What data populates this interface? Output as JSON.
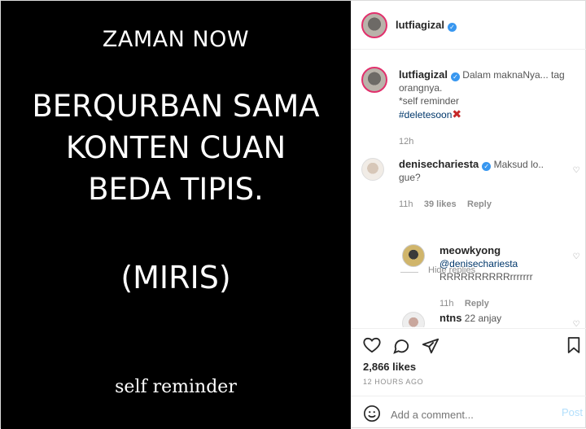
{
  "post_image": {
    "heading": "ZAMAN NOW",
    "line1": "BERQURBAN SAMA",
    "line2": "KONTEN CUAN",
    "line3": "BEDA TIPIS.",
    "line4": "(MIRIS)",
    "footer": "self reminder"
  },
  "header": {
    "username": "lutfiagizal",
    "verified_icon": "verified-badge-icon"
  },
  "caption": {
    "username": "lutfiagizal",
    "text1": "Dalam maknaNya... tag",
    "text2": "orangnya.",
    "text3": "*self reminder",
    "hashtag": "#deletesoon",
    "emoji": "✖",
    "time": "12h"
  },
  "comments": [
    {
      "username": "denisechariesta",
      "text": "Maksud lo..",
      "text2": "gue?",
      "time": "11h",
      "likes": "39 likes",
      "reply": "Reply"
    },
    {
      "username": "meowkyong",
      "mention": "@denisechariesta",
      "text": "RRRRRRRRRRrrrrrrr",
      "time": "11h",
      "reply": "Reply"
    },
    {
      "username": "ntns",
      "text": "22 anjay"
    }
  ],
  "hide_replies": "Hide replies",
  "likes": "2,866 likes",
  "timestamp": "12 HOURS AGO",
  "comment_placeholder": "Add a comment...",
  "post_label": "Post",
  "colors": {
    "verified": "#3897f0",
    "link": "#00376b",
    "muted": "#8e8e8e",
    "post_button": "#b2dffc"
  }
}
